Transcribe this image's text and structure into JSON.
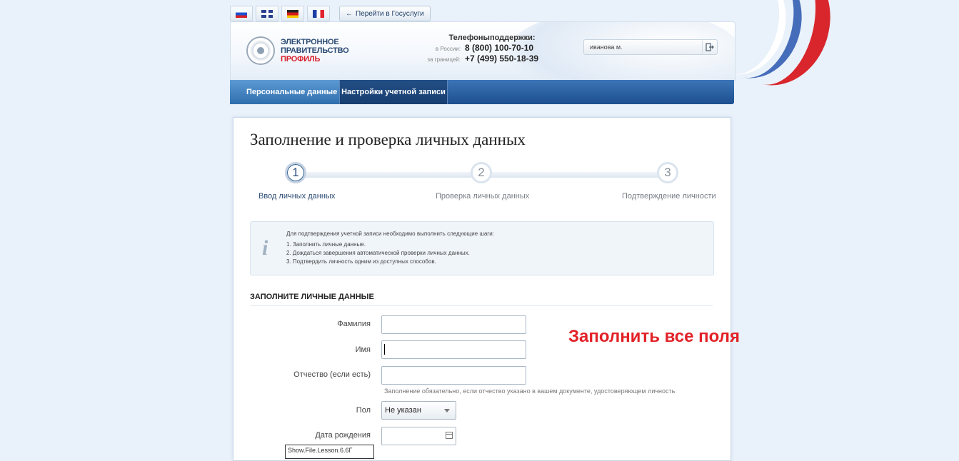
{
  "languages": [
    {
      "code": "ru",
      "icon": "russia-flag-icon"
    },
    {
      "code": "en",
      "icon": "uk-flag-icon"
    },
    {
      "code": "de",
      "icon": "germany-flag-icon"
    },
    {
      "code": "fr",
      "icon": "france-flag-icon"
    }
  ],
  "top": {
    "goto_gosuslugi": "Перейти в Госуслуги",
    "goto_icon": "arrow-left-icon"
  },
  "header": {
    "logo_line1": "ЭЛЕКТРОННОЕ",
    "logo_line2": "ПРАВИТЕЛЬСТВО",
    "logo_line3": "ПРОФИЛЬ",
    "support_title": "Телефоныподдержки:",
    "phone_ru_label": "в России:",
    "phone_ru": "8 (800) 100-70-10",
    "phone_abroad_label": "за границей:",
    "phone_abroad": "+7 (499) 550-18-39",
    "user_name": "иванова м.",
    "logout_icon": "logout-icon"
  },
  "nav": {
    "tabs": [
      {
        "label": "Персональные данные",
        "active": true
      },
      {
        "label": "Настройки учетной записи",
        "active": false
      }
    ]
  },
  "main": {
    "title": "Заполнение и проверка личных данных",
    "steps": [
      {
        "number": "1",
        "label": "Ввод личных данных",
        "active": true
      },
      {
        "number": "2",
        "label": "Проверка личных данных",
        "active": false
      },
      {
        "number": "3",
        "label": "Подтверждение личности",
        "active": false
      }
    ],
    "info": {
      "icon": "info-icon",
      "intro": "Для подтверждения учетной записи необходимо выполнить следующие шаги:",
      "items": [
        "1.  Заполнить личные данные.",
        "2.  Дождаться завершения автоматической проверки личных данных.",
        "3.  Подтвердить личность одним из доступных способов."
      ]
    },
    "section_title": "ЗАПОЛНИТЕ ЛИЧНЫЕ ДАННЫЕ",
    "form": {
      "surname_label": "Фамилия",
      "surname_value": "",
      "name_label": "Имя",
      "name_value": "",
      "patronymic_label": "Отчество (если есть)",
      "patronymic_value": "",
      "patronymic_hint": "Заполнение обязательно, если отчество указано в вашем документе, удостоверяющем личность",
      "gender_label": "Пол",
      "gender_value": "Не указан",
      "birthdate_label": "Дата рождения",
      "birthdate_value": "",
      "calendar_icon": "calendar-icon",
      "tooltip_text": "Show.File.Lesson.6.6Г"
    }
  },
  "annotation": {
    "text": "Заполнить все поля",
    "color": "#e22228"
  }
}
